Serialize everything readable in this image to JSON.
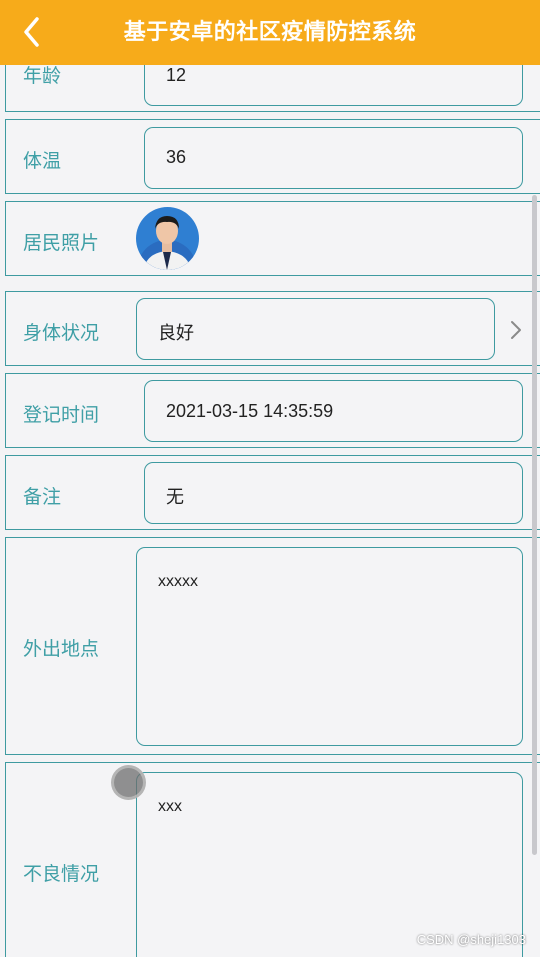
{
  "header": {
    "title": "基于安卓的社区疫情防控系统",
    "back_icon": "chevron-left-icon",
    "color": "#f7ab1a"
  },
  "form": {
    "age": {
      "label": "年龄",
      "value": "12"
    },
    "temperature": {
      "label": "体温",
      "value": "36"
    },
    "photo": {
      "label": "居民照片"
    },
    "health": {
      "label": "身体状况",
      "value": "良好"
    },
    "register_time": {
      "label": "登记时间",
      "value": "2021-03-15 14:35:59"
    },
    "remarks": {
      "label": "备注",
      "value": "无"
    },
    "outing_location": {
      "label": "外出地点",
      "value": "xxxxx"
    },
    "bad_condition": {
      "label": "不良情况",
      "value": "xxx"
    }
  },
  "accent_color": "#3e9aa0",
  "watermark": "CSDN @sheji1303"
}
